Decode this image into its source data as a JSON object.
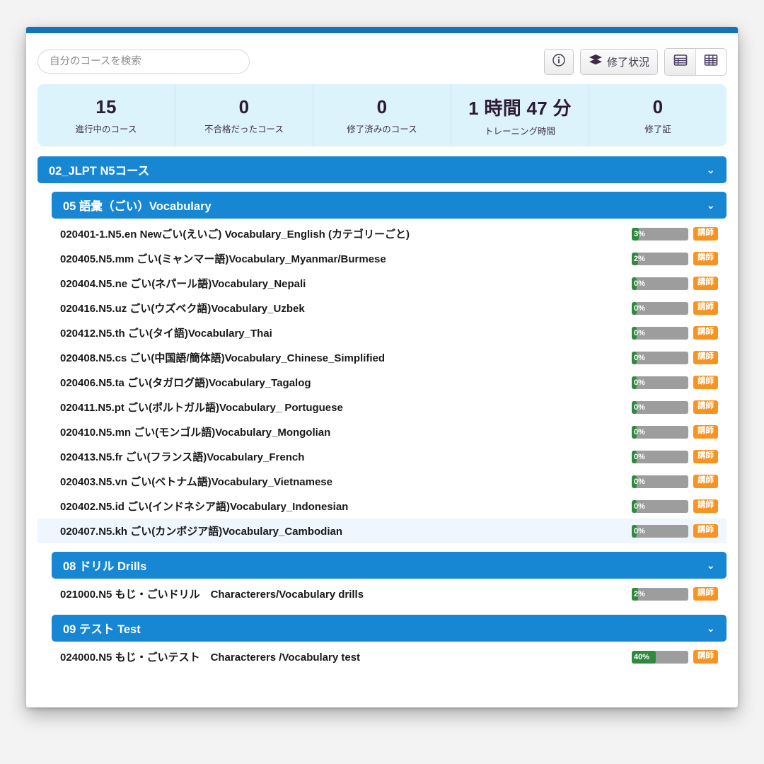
{
  "toolbar": {
    "search_placeholder": "自分のコースを検索",
    "info_icon": "info-circle-icon",
    "status_button_label": "修了状況",
    "status_button_icon": "stacked-layers-icon",
    "list_view_icon": "list-view-icon",
    "grid_view_icon": "grid-view-icon"
  },
  "stats": [
    {
      "value": "15",
      "label": "進行中のコース"
    },
    {
      "value": "0",
      "label": "不合格だったコース"
    },
    {
      "value": "0",
      "label": "修了済みのコース"
    },
    {
      "value": "1 時間 47 分",
      "label": "トレーニング時間"
    },
    {
      "value": "0",
      "label": "修了証"
    }
  ],
  "course_header": {
    "title": "02_JLPT N5コース",
    "chevron": "⌄"
  },
  "sections": [
    {
      "title": "05 語彙（ごい）Vocabulary",
      "chevron": "⌄",
      "rows": [
        {
          "title": "020401-1.N5.en Newごい(えいご) Vocabulary_English (カテゴリーごと)",
          "percent": "3%",
          "fill": 12,
          "badge": "講師",
          "highlight": false
        },
        {
          "title": "020405.N5.mm ごい(ミャンマー語)Vocabulary_Myanmar/Burmese",
          "percent": "2%",
          "fill": 11,
          "badge": "講師",
          "highlight": false
        },
        {
          "title": "020404.N5.ne ごい(ネパール語)Vocabulary_Nepali",
          "percent": "0%",
          "fill": 9,
          "badge": "講師",
          "highlight": false
        },
        {
          "title": "020416.N5.uz ごい(ウズベク語)Vocabulary_Uzbek",
          "percent": "0%",
          "fill": 9,
          "badge": "講師",
          "highlight": false
        },
        {
          "title": "020412.N5.th ごい(タイ語)Vocabulary_Thai",
          "percent": "0%",
          "fill": 9,
          "badge": "講師",
          "highlight": false
        },
        {
          "title": "020408.N5.cs ごい(中国語/簡体語)Vocabulary_Chinese_Simplified",
          "percent": "0%",
          "fill": 9,
          "badge": "講師",
          "highlight": false
        },
        {
          "title": "020406.N5.ta ごい(タガログ語)Vocabulary_Tagalog",
          "percent": "0%",
          "fill": 9,
          "badge": "講師",
          "highlight": false
        },
        {
          "title": "020411.N5.pt ごい(ポルトガル語)Vocabulary_ Portuguese",
          "percent": "0%",
          "fill": 9,
          "badge": "講師",
          "highlight": false
        },
        {
          "title": "020410.N5.mn ごい(モンゴル語)Vocabulary_Mongolian",
          "percent": "0%",
          "fill": 9,
          "badge": "講師",
          "highlight": false
        },
        {
          "title": "020413.N5.fr ごい(フランス語)Vocabulary_French",
          "percent": "0%",
          "fill": 9,
          "badge": "講師",
          "highlight": false
        },
        {
          "title": "020403.N5.vn ごい(ベトナム語)Vocabulary_Vietnamese",
          "percent": "0%",
          "fill": 9,
          "badge": "講師",
          "highlight": false
        },
        {
          "title": "020402.N5.id ごい(インドネシア語)Vocabulary_Indonesian",
          "percent": "0%",
          "fill": 9,
          "badge": "講師",
          "highlight": false
        },
        {
          "title": "020407.N5.kh ごい(カンボジア語)Vocabulary_Cambodian",
          "percent": "0%",
          "fill": 9,
          "badge": "講師",
          "highlight": true
        }
      ]
    },
    {
      "title": "08 ドリル Drills",
      "chevron": "⌄",
      "rows": [
        {
          "title": "021000.N5 もじ・ごいドリル　Characterers/Vocabulary drills",
          "percent": "2%",
          "fill": 11,
          "badge": "講師",
          "highlight": false
        }
      ]
    },
    {
      "title": "09 テスト Test",
      "chevron": "⌄",
      "rows": [
        {
          "title": "024000.N5 もじ・ごいテスト　Characterers /Vocabulary test",
          "percent": "40%",
          "fill": 42,
          "badge": "講師",
          "highlight": false
        }
      ]
    }
  ],
  "colors": {
    "brand_blue": "#1787d4",
    "topbar_blue": "#1573b8",
    "stats_bg": "#ddf3fb",
    "progress_green": "#2f8a3f",
    "progress_track": "#9d9d9d",
    "badge_orange": "#f79320"
  }
}
